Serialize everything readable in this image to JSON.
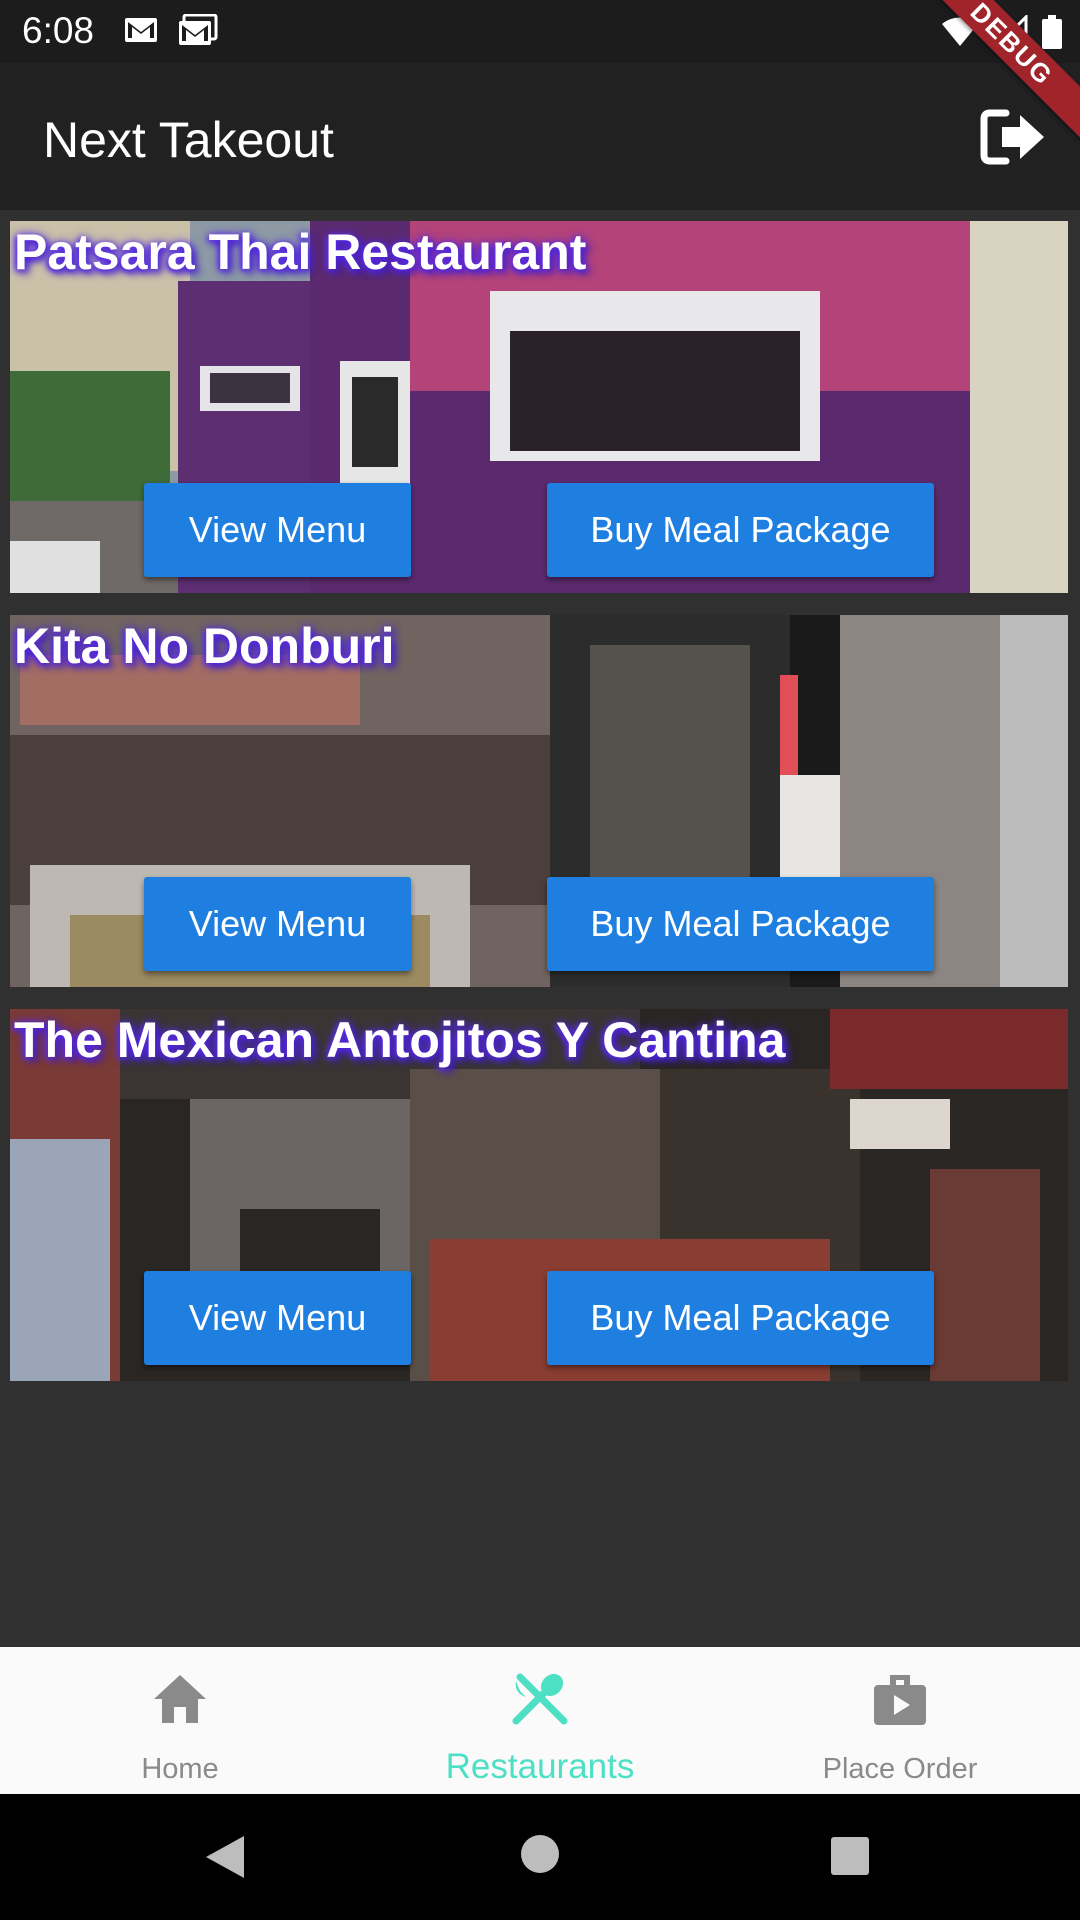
{
  "status_bar": {
    "time": "6:08"
  },
  "debug_label": "DEBUG",
  "app_bar": {
    "title": "Next Takeout"
  },
  "restaurants": [
    {
      "name": "Patsara Thai Restaurant",
      "view_menu": "View Menu",
      "buy_package": "Buy Meal Package"
    },
    {
      "name": "Kita No Donburi",
      "view_menu": "View Menu",
      "buy_package": "Buy Meal Package"
    },
    {
      "name": "The Mexican Antojitos Y Cantina",
      "view_menu": "View Menu",
      "buy_package": "Buy Meal Package"
    }
  ],
  "bottom_nav": {
    "items": [
      {
        "label": "Home",
        "icon": "home-icon",
        "active": false
      },
      {
        "label": "Restaurants",
        "icon": "restaurant-icon",
        "active": true
      },
      {
        "label": "Place Order",
        "icon": "briefcase-icon",
        "active": false
      }
    ]
  },
  "colors": {
    "button": "#1e7fe0",
    "active_nav": "#4de0c4",
    "app_bar": "#212121",
    "background": "#303030"
  }
}
